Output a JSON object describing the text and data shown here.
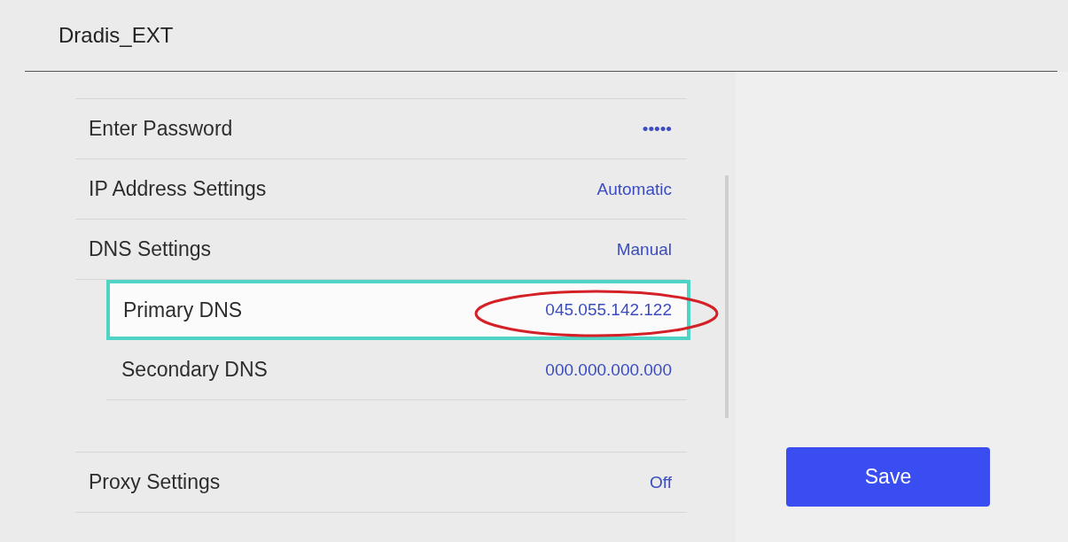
{
  "header": {
    "title": "Dradis_EXT"
  },
  "rows": [
    {
      "kind": "row",
      "label": "Enter Password",
      "value": "•••••",
      "selected": false
    },
    {
      "kind": "row",
      "label": "IP Address Settings",
      "value": "Automatic",
      "selected": false
    },
    {
      "kind": "row",
      "label": "DNS Settings",
      "value": "Manual",
      "selected": false
    },
    {
      "kind": "subrow",
      "label": "Primary DNS",
      "value": "045.055.142.122",
      "selected": true,
      "circled": true
    },
    {
      "kind": "subrow",
      "label": "Secondary DNS",
      "value": "000.000.000.000",
      "selected": false,
      "circled": false
    },
    {
      "kind": "spacer"
    },
    {
      "kind": "row",
      "label": "Proxy Settings",
      "value": "Off",
      "selected": false
    }
  ],
  "save_button": {
    "label": "Save"
  }
}
